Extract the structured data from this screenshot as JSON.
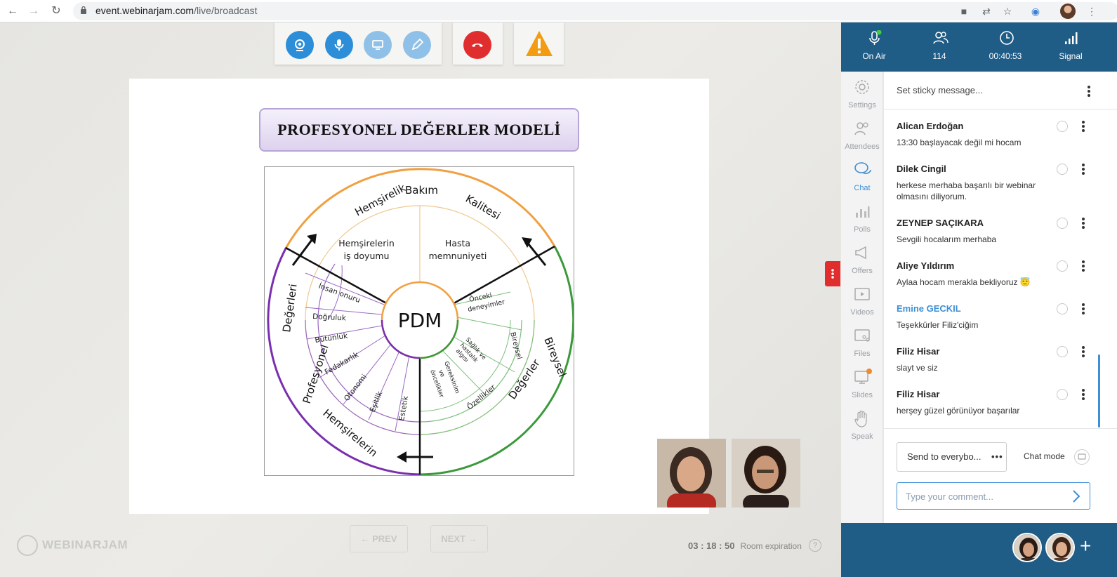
{
  "browser": {
    "url_host": "event.webinarjam.com",
    "url_path": "/live/broadcast"
  },
  "stats": [
    {
      "label": "On Air",
      "icon": "mic-icon"
    },
    {
      "label": "114",
      "icon": "attendees-icon"
    },
    {
      "label": "00:40:53",
      "icon": "clock-icon"
    },
    {
      "label": "Signal",
      "icon": "signal-icon"
    }
  ],
  "rail": [
    {
      "label": "Settings",
      "icon": "gear-icon"
    },
    {
      "label": "Attendees",
      "icon": "attendees-icon"
    },
    {
      "label": "Chat",
      "icon": "chat-icon",
      "active": true
    },
    {
      "label": "Polls",
      "icon": "polls-icon"
    },
    {
      "label": "Offers",
      "icon": "megaphone-icon"
    },
    {
      "label": "Videos",
      "icon": "video-icon"
    },
    {
      "label": "Files",
      "icon": "files-icon"
    },
    {
      "label": "Slides",
      "icon": "slides-icon"
    },
    {
      "label": "Speak",
      "icon": "hand-icon"
    }
  ],
  "chat": {
    "sticky_placeholder": "Set sticky message...",
    "messages": [
      {
        "name": "Alican Erdoğan",
        "text": "13:30 başlayacak değil mi hocam"
      },
      {
        "name": "Dilek Cingil",
        "text": "herkese merhaba başarılı bir webinar olmasını diliyorum."
      },
      {
        "name": "ZEYNEP SAÇIKARA",
        "text": "Sevgili hocalarım merhaba"
      },
      {
        "name": "Aliye Yıldırım",
        "text": "Aylaa hocam merakla bekliyoruz 😇"
      },
      {
        "name": "Emine GECKIL",
        "text": "Teşekkürler Filiz'ciğim",
        "highlight": true
      },
      {
        "name": "Filiz Hisar",
        "text": "slayt ve siz"
      },
      {
        "name": "Filiz Hisar",
        "text": "herşey güzel görünüyor başarılar"
      }
    ],
    "send_to": "Send to everybo...",
    "chat_mode": "Chat mode",
    "comment_placeholder": "Type your comment..."
  },
  "slide": {
    "title": "PROFESYONEL DEĞERLER MODELİ",
    "center": "PDM",
    "outer_top": [
      "Hemşirelik",
      "Bakım",
      "Kalitesi"
    ],
    "outer_right": [
      "Bireysel",
      "Değerler"
    ],
    "outer_left": [
      "Değerleri",
      "Profesyonel",
      "Hemşirelerin"
    ],
    "inner_top_left": [
      "Hemşirelerin",
      "iş doyumu"
    ],
    "inner_top_right": [
      "Hasta",
      "memnuniyeti"
    ],
    "left_values": [
      "İnsan onuru",
      "Doğruluk",
      "Bütünlük",
      "Fedakarlık",
      "Otonomi",
      "Eşitlik",
      "Estetik"
    ],
    "right_values": [
      "Önceki deneyimler",
      "Sağlık ve hastalık algısı",
      "Bireysel",
      "Gereksinim ve öncelikler",
      "Özellikler"
    ]
  },
  "controls": {
    "prev": "PREV",
    "next": "NEXT",
    "logo": "WEBINARJAM",
    "timer": "03 : 18 : 50",
    "room_expiration": "Room expiration",
    "help": "?"
  },
  "colors": {
    "header_blue": "#1f5c86",
    "accent_blue": "#3d8fd6",
    "end_call_red": "#e02e2e",
    "warning_orange": "#f39c12",
    "ring_orange": "#f0a040",
    "ring_purple": "#7a2fb0",
    "ring_green": "#3a9a3a"
  }
}
